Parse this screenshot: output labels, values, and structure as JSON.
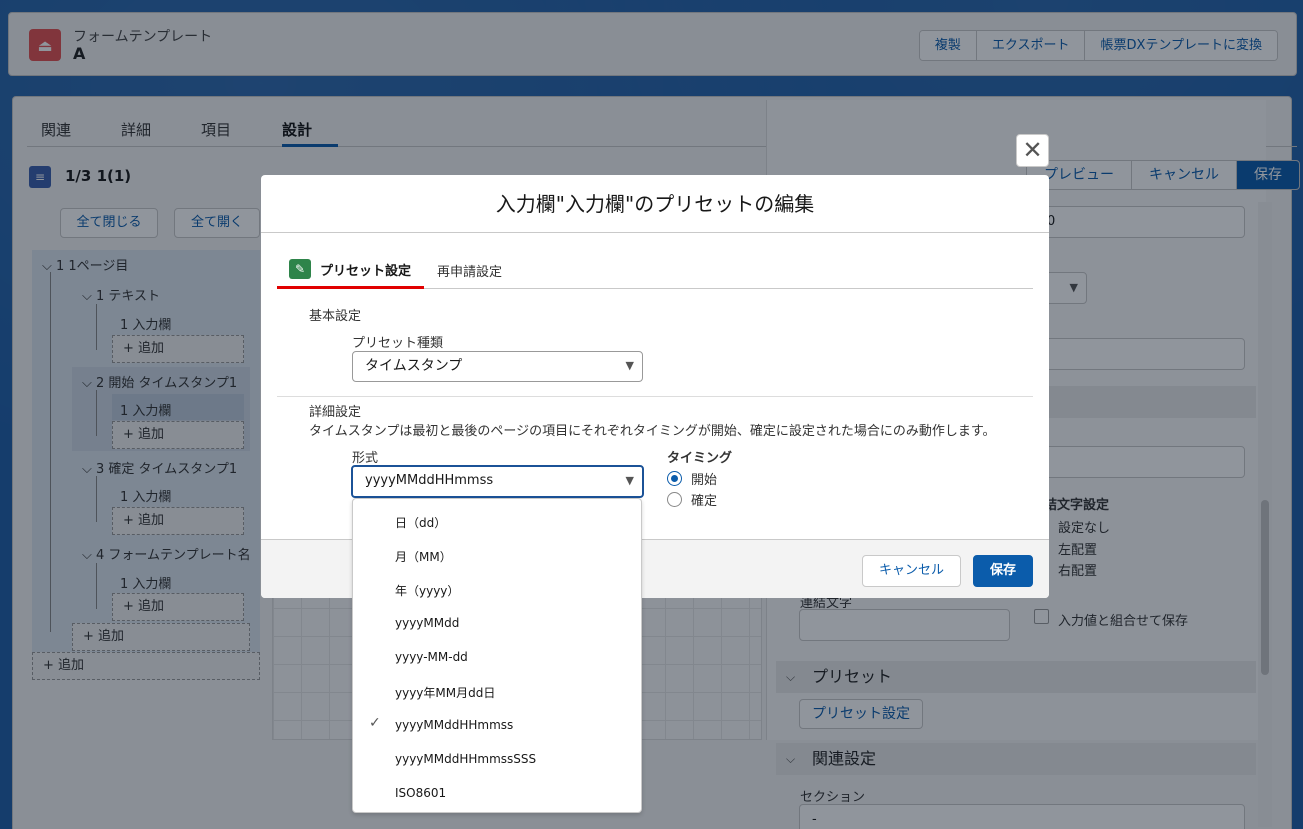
{
  "header": {
    "object_label": "フォームテンプレート",
    "record_name": "A",
    "actions": [
      "複製",
      "エクスポート",
      "帳票DXテンプレートに変換"
    ]
  },
  "tabs": [
    "関連",
    "詳細",
    "項目",
    "設計"
  ],
  "section": {
    "title": "1/3 1(1)"
  },
  "tree_buttons": {
    "collapse_all": "全て閉じる",
    "expand_all": "全て開く"
  },
  "tree": {
    "p1": "1 1ページ目",
    "s1": "1 テキスト",
    "s1i": "1 入力欄",
    "s2": "2 開始 タイムスタンプ1",
    "s2i": "1 入力欄",
    "s3": "3 確定 タイムスタンプ1",
    "s3i": "1 入力欄",
    "s4": "4 フォームテンプレート名",
    "s4i": "1 入力欄",
    "add": "+ 追加"
  },
  "right_panel": {
    "buttons": {
      "preview": "プレビュー",
      "cancel": "キャンセル",
      "save": "保存"
    },
    "field_fragment": "0",
    "join_char_label": "結文字設定",
    "join_options": [
      "設定なし",
      "左配置",
      "右配置"
    ],
    "join_text_label": "連結文字",
    "combine_label": "入力値と組合せて保存",
    "preset_section": "プリセット",
    "preset_button": "プリセット設定",
    "related_section": "関連設定",
    "section_label": "セクション",
    "section_value": "-"
  },
  "modal": {
    "title": "入力欄\"入力欄\"のプリセットの編集",
    "tab_active": "プリセット設定",
    "tab_other": "再申請設定",
    "basic_heading": "基本設定",
    "preset_type_label": "プリセット種類",
    "preset_type_value": "タイムスタンプ",
    "detail_heading": "詳細設定",
    "detail_note": "タイムスタンプは最初と最後のページの項目にそれぞれタイミングが開始、確定に設定された場合にのみ動作します。",
    "format_label": "形式",
    "format_value": "yyyyMMddHHmmss",
    "timing_label": "タイミング",
    "timing_options": [
      "開始",
      "確定"
    ],
    "cancel": "キャンセル",
    "save": "保存"
  },
  "dropdown_options": [
    "日（dd）",
    "月（MM）",
    "年（yyyy）",
    "yyyyMMdd",
    "yyyy-MM-dd",
    "yyyy年MM月dd日",
    "yyyyMMddHHmmss",
    "yyyyMMddHHmmssSSS",
    "ISO8601"
  ],
  "selected_option": "yyyyMMddHHmmss",
  "colors": {
    "brand": "#0b5cab",
    "header_icon": "#e35050",
    "active_tab_underline": "#e10000",
    "preset_icon": "#2e844a"
  }
}
